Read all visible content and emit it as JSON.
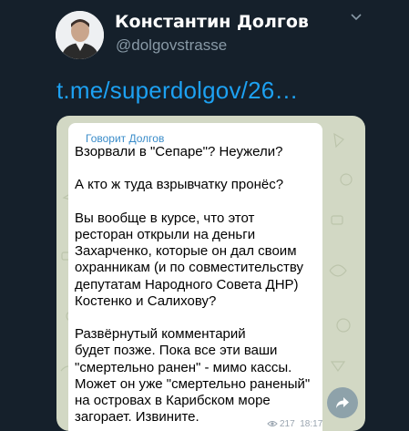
{
  "author": {
    "name": "Константин Долгов",
    "handle": "@dolgovstrasse"
  },
  "tweet": {
    "link_text": "t.me/superdolgov/26…"
  },
  "card": {
    "forwarded_from": "Говорит Долгов",
    "message": "Взорвали в \"Сепаре\"? Неужели?\n\nА кто ж туда взрывчатку пронёс?\n\nВы вообще в курсе, что этот\nресторан открыли на деньги\nЗахарченко, которые он дал своим\nохранникам (и по совместительству\nдепутатам Народного Совета ДНР)\nКостенко и Салихову?\n\nРазвёрнутый комментарий\nбудет позже. Пока все эти ваши\n\"смертельно ранен\" - мимо кассы.\nМожет он уже \"смертельно раненый\"\nна островах в Карибском море\nзагорает. Извините.",
    "views": "217",
    "time": "18:17"
  },
  "icons": {
    "caret": "chevron-down-icon",
    "views": "eye-icon",
    "share": "share-arrow-icon"
  },
  "colors": {
    "background": "#15202b",
    "link": "#1da1f2",
    "handle": "#8899a6",
    "forwarded": "#3a8cc9",
    "card_bg": "#d2d8c4"
  }
}
